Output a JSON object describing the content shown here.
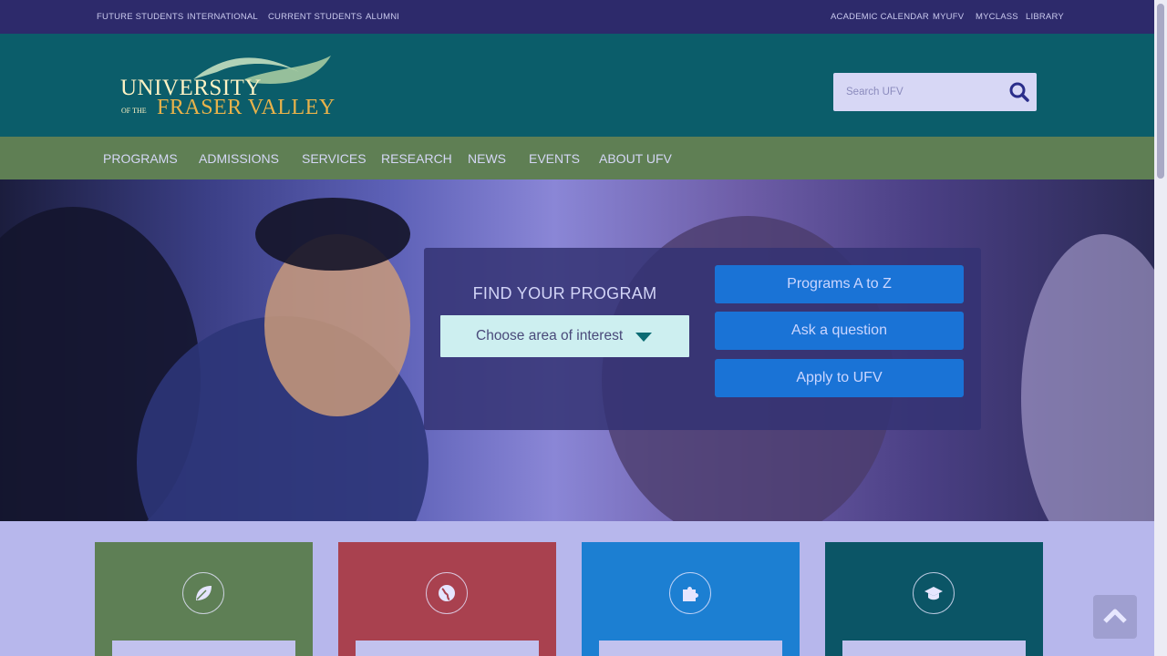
{
  "topbar": {
    "left_links": [
      "FUTURE STUDENTS",
      "INTERNATIONAL",
      "CURRENT STUDENTS",
      "ALUMNI"
    ],
    "right_links": [
      "ACADEMIC CALENDAR",
      "MYUFV",
      "MYCLASS",
      "LIBRARY"
    ]
  },
  "logo": {
    "line1": "UNIVERSITY",
    "ofthe": "OF THE",
    "line2": "FRASER VALLEY"
  },
  "search": {
    "placeholder": "Search UFV",
    "icon": "search-icon"
  },
  "nav": {
    "items": [
      "PROGRAMS",
      "ADMISSIONS",
      "SERVICES",
      "RESEARCH",
      "NEWS",
      "EVENTS",
      "ABOUT UFV"
    ]
  },
  "hero": {
    "heading": "FIND YOUR PROGRAM",
    "select_label": "Choose area of interest",
    "buttons": [
      "Programs A to Z",
      "Ask a question",
      "Apply to UFV"
    ]
  },
  "tiles": [
    {
      "color": "#5e7f55",
      "icon": "leaf-icon"
    },
    {
      "color": "#a9414f",
      "icon": "globe-icon"
    },
    {
      "color": "#1c7fd2",
      "icon": "puzzle-icon"
    },
    {
      "color": "#0b5566",
      "icon": "graduation-cap-icon"
    }
  ],
  "colors": {
    "topbar": "#2d2a6b",
    "header": "#0b5d6a",
    "nav": "#5f7f54",
    "primary_button": "#1a73d6"
  }
}
